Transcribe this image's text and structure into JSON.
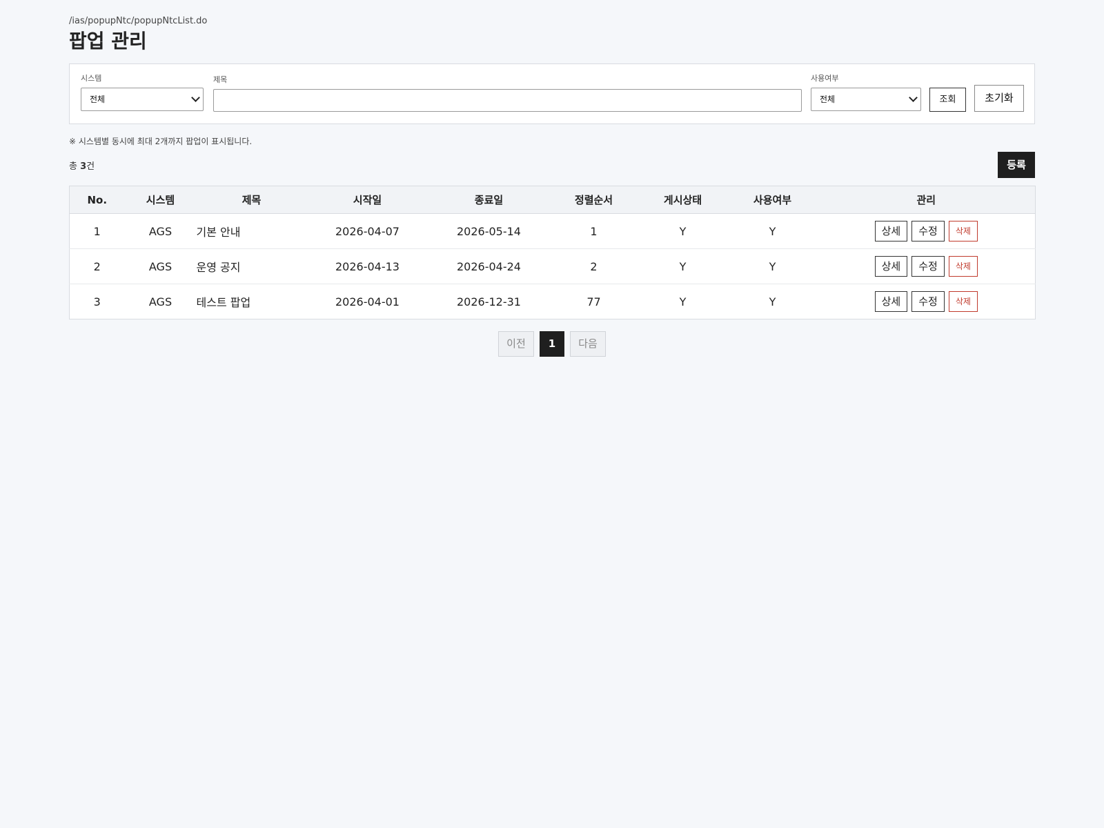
{
  "page": {
    "path": "/ias/popupNtc/popupNtcList.do",
    "title": "팝업 관리"
  },
  "search": {
    "system_label": "시스템",
    "system_value": "전체",
    "title_label": "제목",
    "title_value": "",
    "use_label": "사용여부",
    "use_value": "전체",
    "search_button": "조회",
    "reset_button": "초기화"
  },
  "notice": "※ 시스템별 동시에 최대 2개까지 팝업이 표시됩니다.",
  "summary": {
    "prefix": "총 ",
    "count": "3",
    "suffix": "건",
    "register_button": "등록"
  },
  "table": {
    "headers": [
      "No.",
      "시스템",
      "제목",
      "시작일",
      "종료일",
      "정렬순서",
      "게시상태",
      "사용여부",
      "관리"
    ],
    "actions": {
      "detail": "상세",
      "edit": "수정",
      "delete": "삭제"
    },
    "rows": [
      {
        "no": "1",
        "system": "AGS",
        "title": "기본 안내",
        "start": "2026-04-07",
        "end": "2026-05-14",
        "order": "1",
        "status": "Y",
        "use": "Y"
      },
      {
        "no": "2",
        "system": "AGS",
        "title": "운영 공지",
        "start": "2026-04-13",
        "end": "2026-04-24",
        "order": "2",
        "status": "Y",
        "use": "Y"
      },
      {
        "no": "3",
        "system": "AGS",
        "title": "테스트 팝업",
        "start": "2026-04-01",
        "end": "2026-12-31",
        "order": "77",
        "status": "Y",
        "use": "Y"
      }
    ]
  },
  "pagination": {
    "prev": "이전",
    "current": "1",
    "next": "다음"
  },
  "colors": {
    "background": "#f5f7fa",
    "dark_button": "#1f1f1f",
    "delete_red": "#c0392b"
  }
}
